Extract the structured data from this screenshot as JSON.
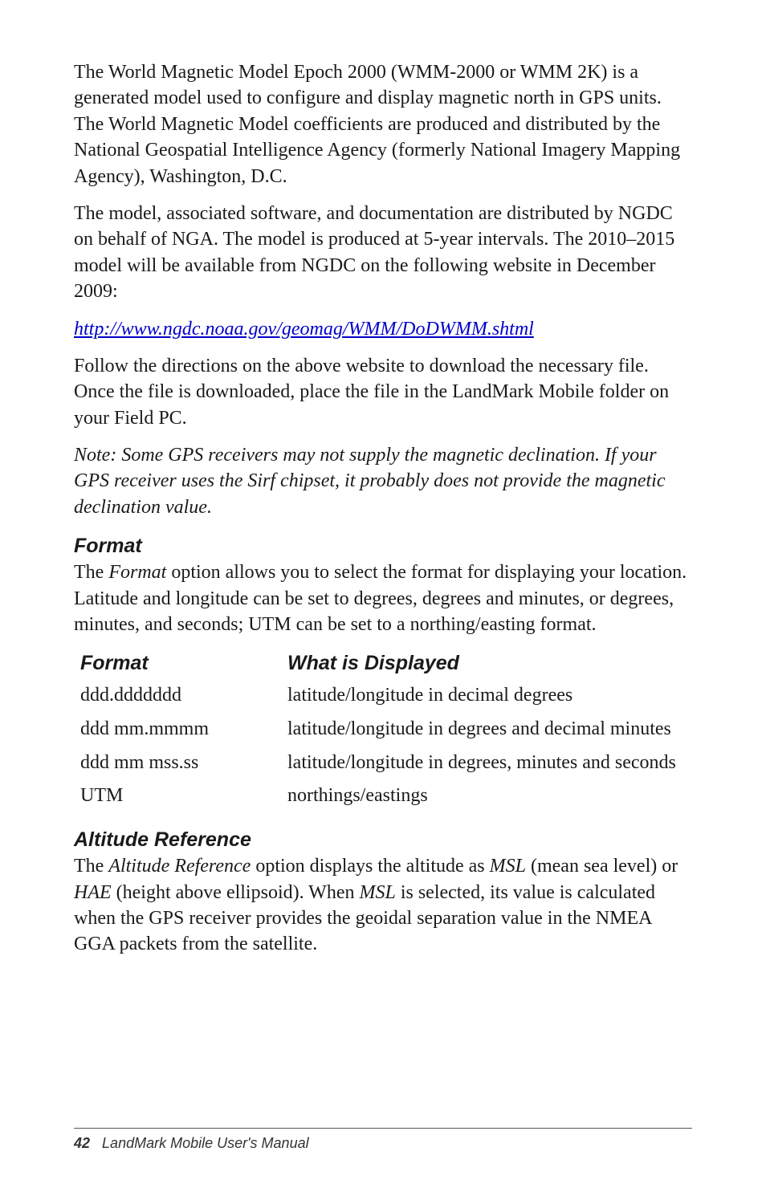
{
  "paragraphs": {
    "p1": "The World Magnetic Model Epoch 2000 (WMM-2000 or WMM 2K) is a generated model used to configure and display magnetic north in GPS units. The World Magnetic Model coefficients are produced and distributed by the National Geospatial Intelligence Agency (formerly National Imagery Mapping Agency), Washington, D.C.",
    "p2": "The model, associated software, and documentation are distributed by NGDC on behalf of NGA. The model is produced at 5-year intervals. The 2010–2015 model will be available from NGDC on the following website in December 2009:",
    "link": "http://www.ngdc.noaa.gov/geomag/WMM/DoDWMM.shtml",
    "p3": "Follow the directions on the above website to download the necessary file. Once the file is downloaded, place the file in the LandMark Mobile folder on your Field PC.",
    "note": "Note: Some GPS receivers may not supply the magnetic declination. If your GPS receiver uses the Sirf chipset, it probably does not provide the magnetic declination value."
  },
  "format_section": {
    "heading": "Format",
    "intro_pre": "The ",
    "intro_ital": "Format",
    "intro_post": " option allows you to select the format for displaying your location. Latitude and longitude can be set to degrees, degrees and minutes, or degrees, minutes, and seconds; UTM can be set to a northing/easting format.",
    "table": {
      "h1": "Format",
      "h2": "What is Displayed",
      "rows": [
        {
          "c1": "ddd.ddddddd",
          "c2": "latitude/longitude in decimal degrees"
        },
        {
          "c1": "ddd mm.mmmm",
          "c2": "latitude/longitude in degrees and decimal minutes"
        },
        {
          "c1": "ddd mm mss.ss",
          "c2": "latitude/longitude in degrees, minutes and seconds"
        },
        {
          "c1": "UTM",
          "c2": "northings/eastings"
        }
      ]
    }
  },
  "altitude_section": {
    "heading": "Altitude Reference",
    "parts": {
      "t1": "The ",
      "i1": "Altitude Reference",
      "t2": " option displays the altitude as ",
      "i2": "MSL",
      "t3": " (mean sea level) or ",
      "i3": "HAE",
      "t4": " (height above ellipsoid). When ",
      "i4": "MSL",
      "t5": " is selected, its value is calculated when the GPS receiver provides the geoidal separation value in the NMEA GGA packets from the satellite."
    }
  },
  "footer": {
    "page": "42",
    "title": "LandMark Mobile User's Manual"
  }
}
